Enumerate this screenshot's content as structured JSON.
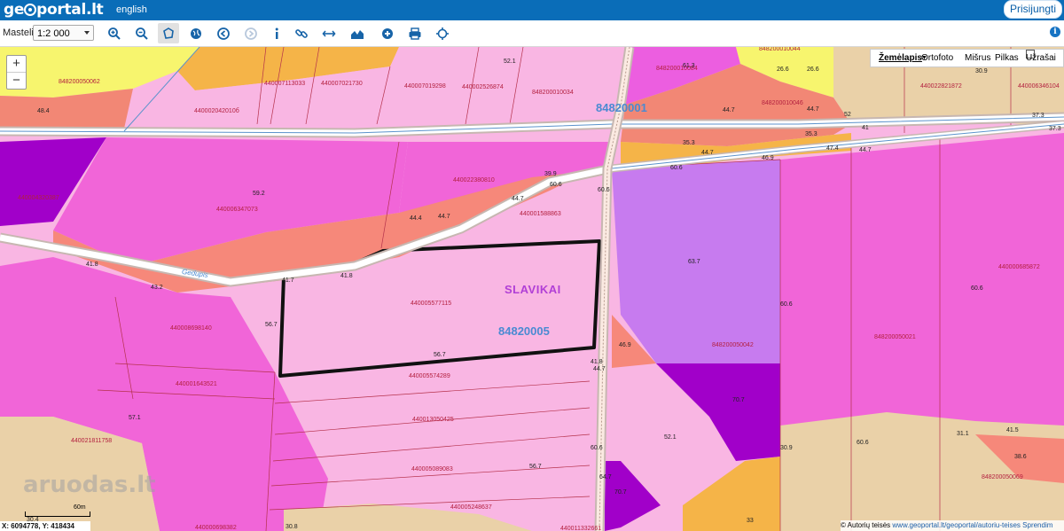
{
  "header": {
    "logo_left": "ge",
    "logo_right": "portal.lt",
    "lang_link": "english",
    "login_button": "Prisijungti"
  },
  "toolbar": {
    "scale_label": "Mastelis:",
    "scale_value": "1:2 000",
    "tools": [
      "zoom-in-icon",
      "zoom-out-icon",
      "lasso-icon",
      "globe-icon",
      "back-icon",
      "forward-icon",
      "info-icon",
      "link-icon",
      "measure-icon",
      "profile-icon",
      "add-icon",
      "print-icon",
      "locate-icon"
    ]
  },
  "layers": {
    "zemelapis": "Žemėlapis",
    "ortofoto": "Ortofoto",
    "misrus": "Mišrus",
    "pilkas": "Pilkas",
    "uzrasai": "Užrašai"
  },
  "zoom": {
    "plus": "+",
    "minus": "−"
  },
  "status": {
    "coords": "X: 6094778, Y: 418434",
    "scalebar": "60m",
    "copyright_prefix": "© Autorių teisės",
    "copyright_link": "www.geoportal.lt/geoportal/autoriu-teises",
    "copyright_suffix": "Sprendim"
  },
  "watermark": "aruodas.lt",
  "map_labels": {
    "village": "SLAVIKAI",
    "block_main": "84820005",
    "block_north": "84820001",
    "road": "Gedupis",
    "parcels": [
      "848200050062",
      "440002042010б",
      "440007113033",
      "440007021730",
      "440007019298",
      "440002526874",
      "848200010034",
      "848200010084",
      "848200010044",
      "440022821872",
      "440006346104",
      "440022380810",
      "440006347073",
      "440001588863",
      "440005577115",
      "440008698140",
      "440001643521",
      "440005574289",
      "440013050425",
      "440005089083",
      "440005248637",
      "440021811758",
      "848200050042",
      "848200050021",
      "440000685872",
      "848200010046",
      "848200050069",
      "440004320387",
      "440000698382",
      "440011332661"
    ],
    "numbers": [
      "52.1",
      "61.3",
      "26.6",
      "26.6",
      "30.9",
      "48.4",
      "44.7",
      "37.3",
      "37.3",
      "35.3",
      "35.3",
      "52",
      "44.7",
      "41",
      "47.4",
      "44.7",
      "46.9",
      "44.7",
      "60.6",
      "39.9",
      "60.6",
      "59.2",
      "44.7",
      "44.4",
      "44.7",
      "41.8",
      "41.8",
      "41.7",
      "43.2",
      "56.7",
      "60.6",
      "63.7",
      "60.6",
      "60.6",
      "56.7",
      "46.9",
      "41.8",
      "44.7",
      "70.7",
      "57.1",
      "52.1",
      "30.9",
      "31.1",
      "41.5",
      "38.6",
      "60.6",
      "64.7",
      "56.7",
      "70.7",
      "30.4",
      "30.8",
      "33",
      "60.6"
    ]
  }
}
